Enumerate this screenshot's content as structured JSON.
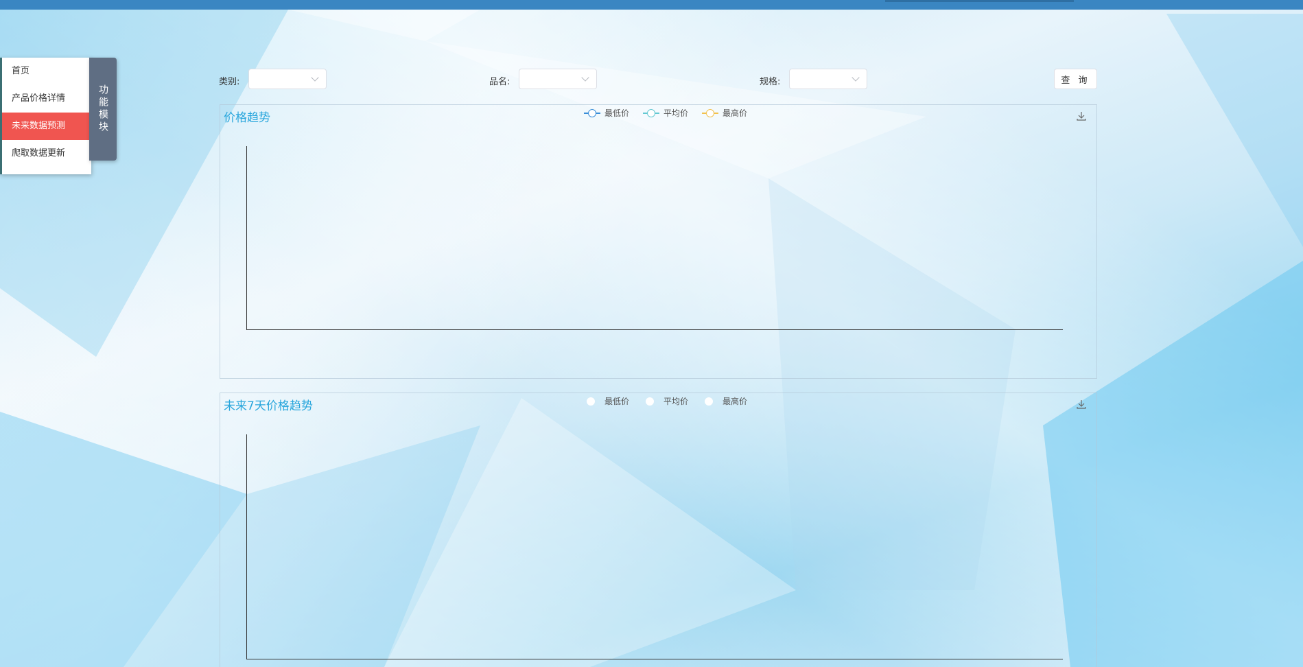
{
  "menu": {
    "items": [
      {
        "label": "首页",
        "active": false
      },
      {
        "label": "产品价格详情",
        "active": false
      },
      {
        "label": "未来数据预测",
        "active": true
      },
      {
        "label": "爬取数据更新",
        "active": false
      }
    ],
    "tab_label": "功能模块"
  },
  "filters": {
    "category_label": "类别:",
    "name_label": "品名:",
    "spec_label": "规格:",
    "query_label": "查 询"
  },
  "charts": [
    {
      "title": "价格趋势",
      "legend": [
        {
          "name": "最低价",
          "color": "#3a8ed8"
        },
        {
          "name": "平均价",
          "color": "#64c8d2"
        },
        {
          "name": "最高价",
          "color": "#f2c14e"
        }
      ],
      "download_icon": "download-icon"
    },
    {
      "title": "未来7天价格趋势",
      "legend": [
        {
          "name": "最低价",
          "color": "#ffffff"
        },
        {
          "name": "平均价",
          "color": "#ffffff"
        },
        {
          "name": "最高价",
          "color": "#ffffff"
        }
      ],
      "download_icon": "download-icon"
    }
  ],
  "colors": {
    "topbar": "#3a86c2",
    "menu_active": "#f05550",
    "menu_tab": "#5f6e83",
    "chart_title": "#29a6dc"
  }
}
